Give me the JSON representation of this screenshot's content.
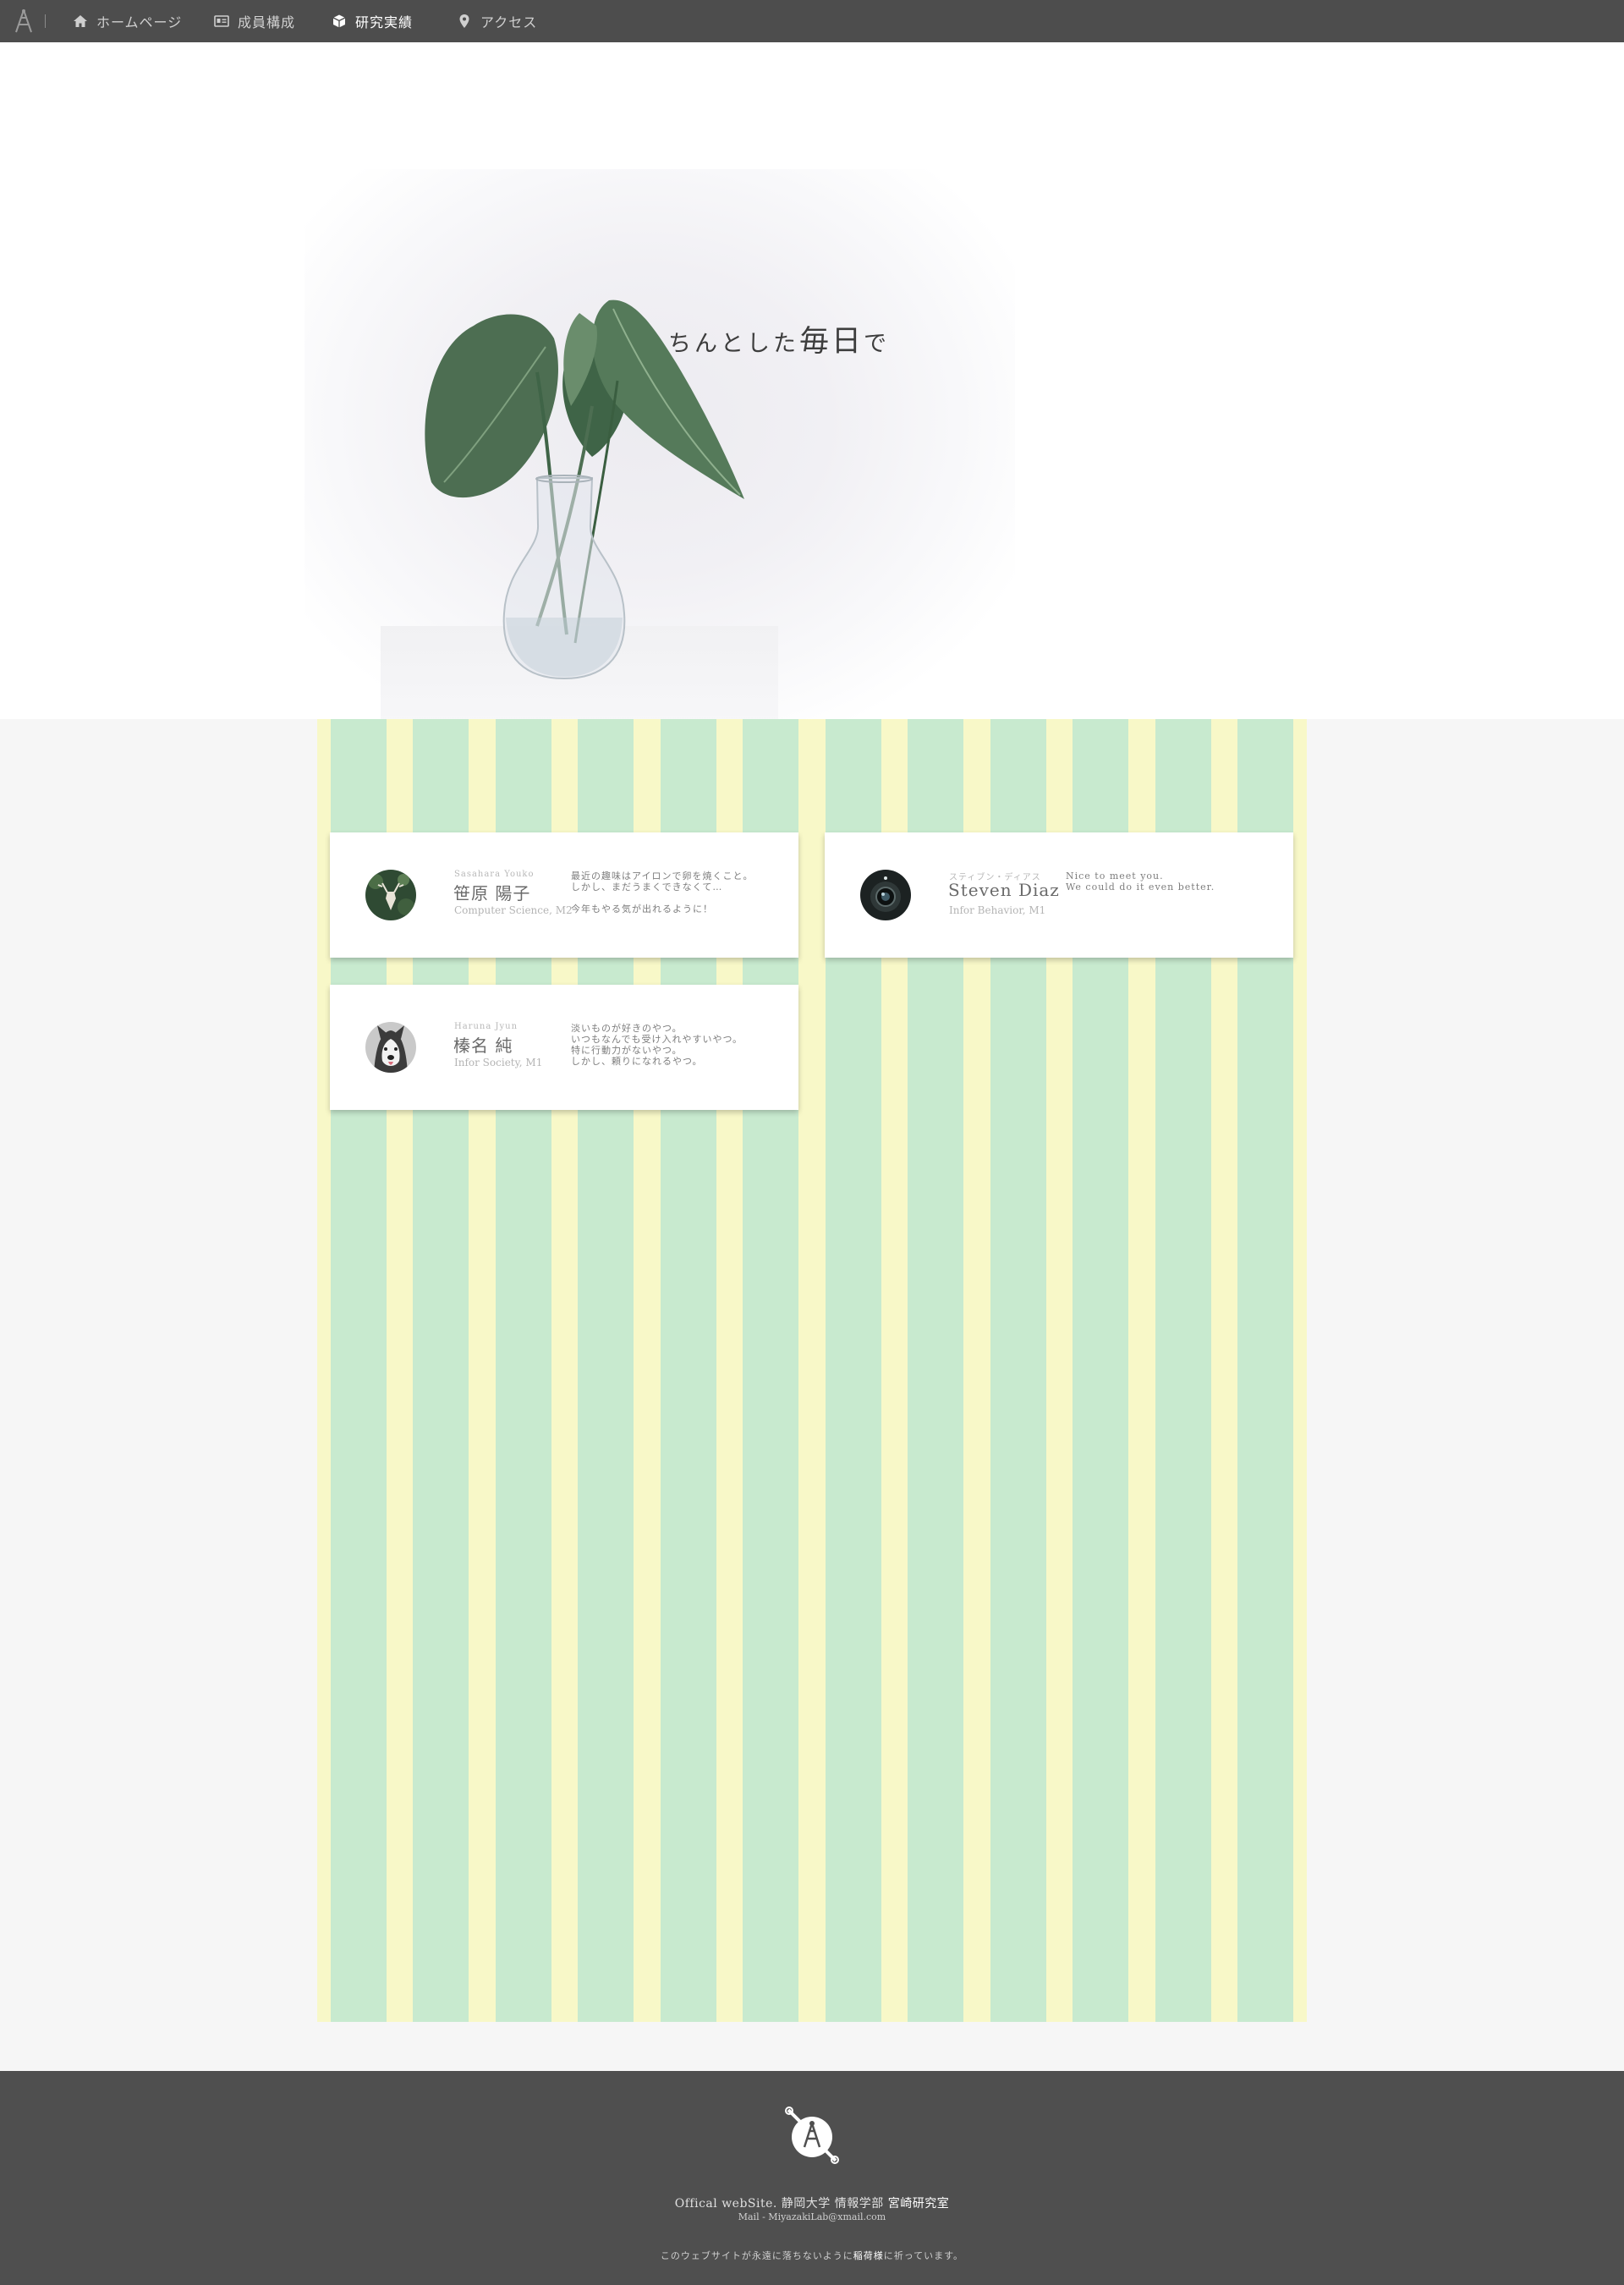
{
  "nav": {
    "logo_icon": "lab-logo-icon",
    "items": [
      {
        "label": "ホームページ",
        "icon": "home-icon"
      },
      {
        "label": "成員構成",
        "icon": "id-card-icon"
      },
      {
        "label": "研究実績",
        "icon": "cube-icon",
        "active": true
      },
      {
        "label": "アクセス",
        "icon": "map-pin-icon"
      }
    ]
  },
  "hero": {
    "tagline_small": "ちんとした",
    "tagline_big": "毎日",
    "tagline_end": "で"
  },
  "members": [
    {
      "roman": "Sasahara Youko",
      "name": "笹原 陽子",
      "dept": "Computer Science, M2",
      "message": "最近の趣味はアイロンで卵を焼くこと。\nしかし、まだうまくできなくて…\n\n今年もやる気が出れるように！",
      "avatar_icon": "deer-avatar-icon"
    },
    {
      "roman": "スティブン・ディアス",
      "name": "Steven Diaz",
      "dept": "Infor Behavior, M1",
      "message": "Nice to meet you.\nWe could do it even better.",
      "avatar_icon": "camera-lens-avatar-icon"
    },
    {
      "roman": "Haruna Jyun",
      "name": "榛名 純",
      "dept": "Infor Society, M1",
      "message": "淡いものが好きのやつ。\nいつもなんでも受け入れやすいやつ。\n特に行動力がないやつ。\nしかし、頼りになれるやつ。",
      "avatar_icon": "husky-avatar-icon"
    }
  ],
  "colors": {
    "nav_bg": "#4d4d4d",
    "stripe_green": "#c8eacf",
    "stripe_yellow": "#f8f8c8",
    "footer_bg": "#4f4f4f"
  },
  "footer": {
    "logo_icon": "lab-logo-icon",
    "site_prefix": "Offical webSite. 静岡大学 情報学部",
    "lab_name": "宮崎研究室",
    "mail": "Mail - MiyazakiLab@xmail.com",
    "note_before": "このウェブサイトが永遠に落ちないように",
    "note_highlight": "稲荷様",
    "note_after": "に祈っています。"
  }
}
